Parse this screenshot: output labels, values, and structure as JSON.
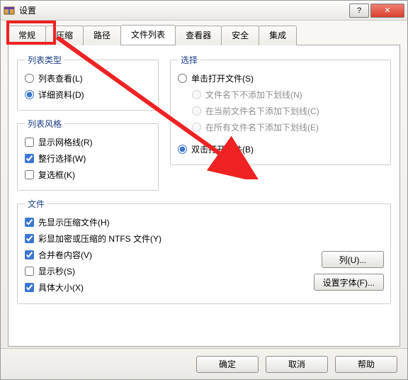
{
  "window": {
    "title": "设置",
    "help_glyph": "?",
    "close_glyph": "✕"
  },
  "tabs": [
    {
      "label": "常规"
    },
    {
      "label": "压缩"
    },
    {
      "label": "路径"
    },
    {
      "label": "文件列表"
    },
    {
      "label": "查看器"
    },
    {
      "label": "安全"
    },
    {
      "label": "集成"
    }
  ],
  "active_tab_index": 3,
  "groups": {
    "list_type": {
      "legend": "列表类型",
      "items": [
        {
          "label": "列表查看(L)",
          "checked": false
        },
        {
          "label": "详细资料(D)",
          "checked": true
        }
      ]
    },
    "list_style": {
      "legend": "列表风格",
      "items": [
        {
          "label": "显示网格线(R)",
          "checked": false
        },
        {
          "label": "整行选择(W)",
          "checked": true
        },
        {
          "label": "复选框(K)",
          "checked": false
        }
      ]
    },
    "selection": {
      "legend": "选择",
      "single": {
        "label": "单击打开文件(S)",
        "checked": false
      },
      "single_sub": [
        {
          "label": "文件名下不添加下划线(N)"
        },
        {
          "label": "在当前文件名下添加下划线(C)"
        },
        {
          "label": "在所有文件名下添加下划线(E)"
        }
      ],
      "double": {
        "label": "双击打开文件(B)",
        "checked": true
      }
    },
    "files": {
      "legend": "文件",
      "items": [
        {
          "label": "先显示压缩文件(H)",
          "checked": true
        },
        {
          "label": "彩显加密或压缩的 NTFS 文件(Y)",
          "checked": true
        },
        {
          "label": "合并卷内容(V)",
          "checked": true
        },
        {
          "label": "显示秒(S)",
          "checked": false
        },
        {
          "label": "具体大小(X)",
          "checked": true
        }
      ]
    }
  },
  "side_buttons": {
    "columns": "列(U)...",
    "set_font": "设置字体(F)..."
  },
  "bottom_buttons": {
    "ok": "确定",
    "cancel": "取消",
    "help": "帮助"
  }
}
